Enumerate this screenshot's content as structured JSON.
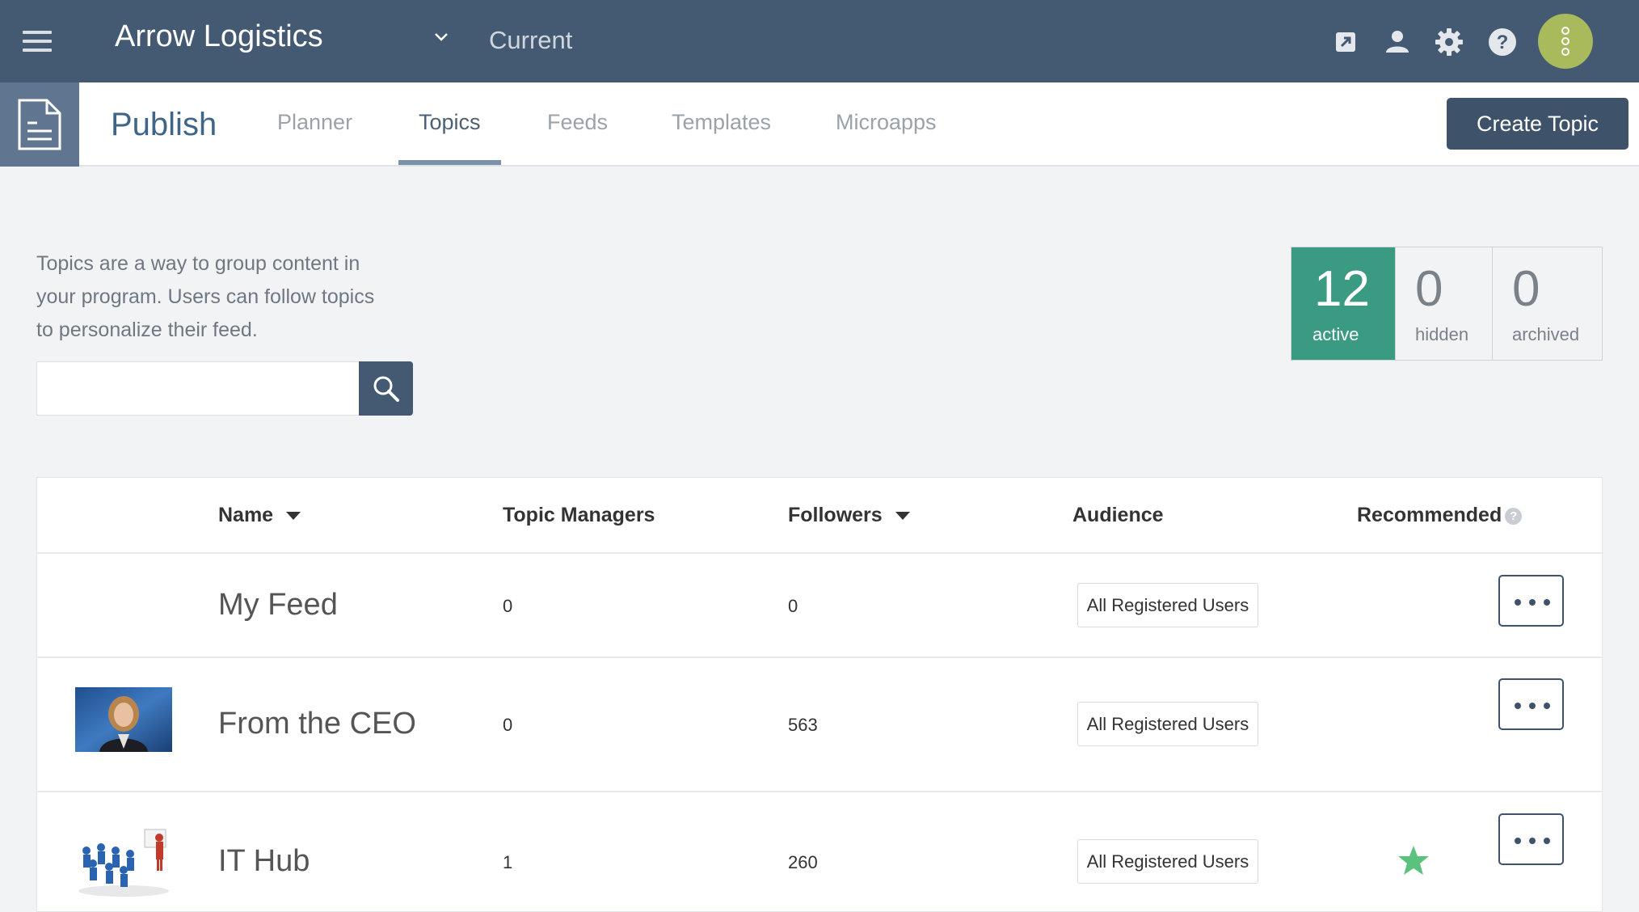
{
  "header": {
    "org_name": "Arrow Logistics",
    "environment": "Current"
  },
  "subnav": {
    "section_title": "Publish",
    "tabs": [
      {
        "label": "Planner"
      },
      {
        "label": "Topics"
      },
      {
        "label": "Feeds"
      },
      {
        "label": "Templates"
      },
      {
        "label": "Microapps"
      }
    ],
    "active_tab": "Topics",
    "create_button": "Create Topic"
  },
  "intro": {
    "description": "Topics are a way to group content in your program. Users can follow topics to personalize their feed.",
    "search_placeholder": ""
  },
  "stats": [
    {
      "count": "12",
      "label": "active"
    },
    {
      "count": "0",
      "label": "hidden"
    },
    {
      "count": "0",
      "label": "archived"
    }
  ],
  "table": {
    "columns": {
      "name": "Name",
      "managers": "Topic Managers",
      "followers": "Followers",
      "audience": "Audience",
      "recommended": "Recommended"
    },
    "rows": [
      {
        "name": "My Feed",
        "managers": "0",
        "followers": "0",
        "audience": "All Registered Users",
        "recommended": false,
        "thumbnail": "none"
      },
      {
        "name": "From the CEO",
        "managers": "0",
        "followers": "563",
        "audience": "All Registered Users",
        "recommended": false,
        "thumbnail": "ceo-portrait"
      },
      {
        "name": "IT Hub",
        "managers": "1",
        "followers": "260",
        "audience": "All Registered Users",
        "recommended": true,
        "thumbnail": "meeting-figures"
      }
    ]
  },
  "colors": {
    "topbar": "#445a72",
    "accent_active": "#3a9b82",
    "button_dark": "#3e5269",
    "avatar": "#a8ba5c",
    "star": "#5bc27e"
  },
  "icons": [
    "menu-icon",
    "chevron-down-icon",
    "external-link-icon",
    "user-icon",
    "gear-icon",
    "help-icon",
    "avatar-icon",
    "document-icon",
    "search-icon",
    "more-icon",
    "star-icon"
  ]
}
